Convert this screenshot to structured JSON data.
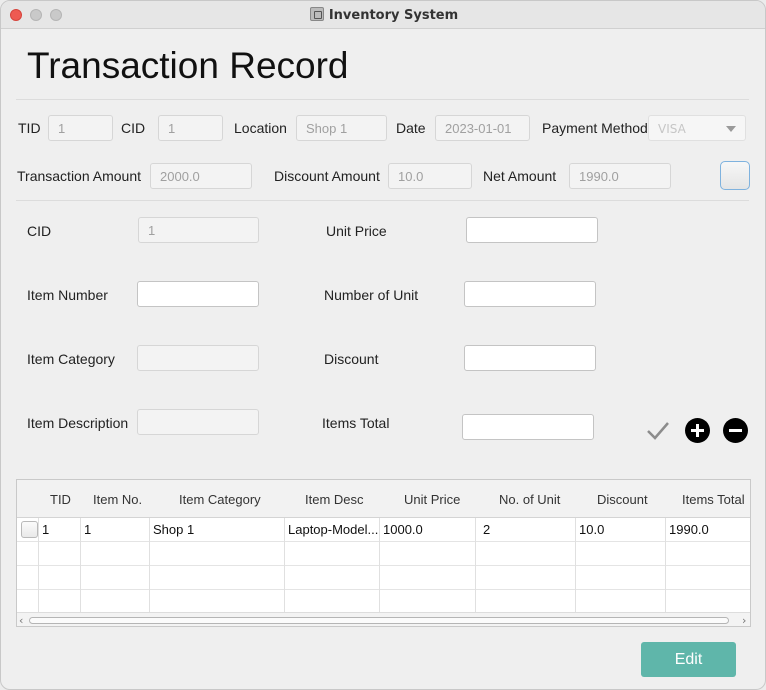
{
  "window": {
    "title": "Inventory System"
  },
  "page_title": "Transaction Record",
  "header": {
    "tid_label": "TID",
    "tid_value": "1",
    "cid_label": "CID",
    "cid_value": "1",
    "location_label": "Location",
    "location_value": "Shop 1",
    "date_label": "Date",
    "date_value": "2023-01-01",
    "payment_label": "Payment Method",
    "payment_value": "VISA",
    "trans_amount_label": "Transaction Amount",
    "trans_amount_value": "2000.0",
    "discount_amount_label": "Discount Amount",
    "discount_amount_value": "10.0",
    "net_amount_label": "Net Amount",
    "net_amount_value": "1990.0"
  },
  "form": {
    "cid_label": "CID",
    "cid_value": "1",
    "item_number_label": "Item Number",
    "item_number_value": "",
    "item_category_label": "Item Category",
    "item_category_value": "",
    "item_description_label": "Item Description",
    "item_description_value": "",
    "unit_price_label": "Unit Price",
    "unit_price_value": "",
    "number_of_unit_label": "Number of Unit",
    "number_of_unit_value": "",
    "discount_label": "Discount",
    "discount_value": "",
    "items_total_label": "Items Total",
    "items_total_value": ""
  },
  "icons": {
    "confirm": "check-icon",
    "add": "plus-circle-icon",
    "remove": "minus-circle-icon"
  },
  "table": {
    "columns": [
      "TID",
      "Item No.",
      "Item Category",
      "Item Desc",
      "Unit Price",
      "No. of Unit",
      "Discount",
      "Items Total"
    ],
    "rows": [
      {
        "tid": "1",
        "item_no": "1",
        "category": "Shop 1",
        "desc": "Laptop-Model...",
        "unit_price": "1000.0",
        "units": "2",
        "discount": "10.0",
        "total": "1990.0"
      }
    ]
  },
  "buttons": {
    "edit": "Edit"
  },
  "colors": {
    "accent": "#5fb6aa",
    "close": "#ee5a52"
  }
}
